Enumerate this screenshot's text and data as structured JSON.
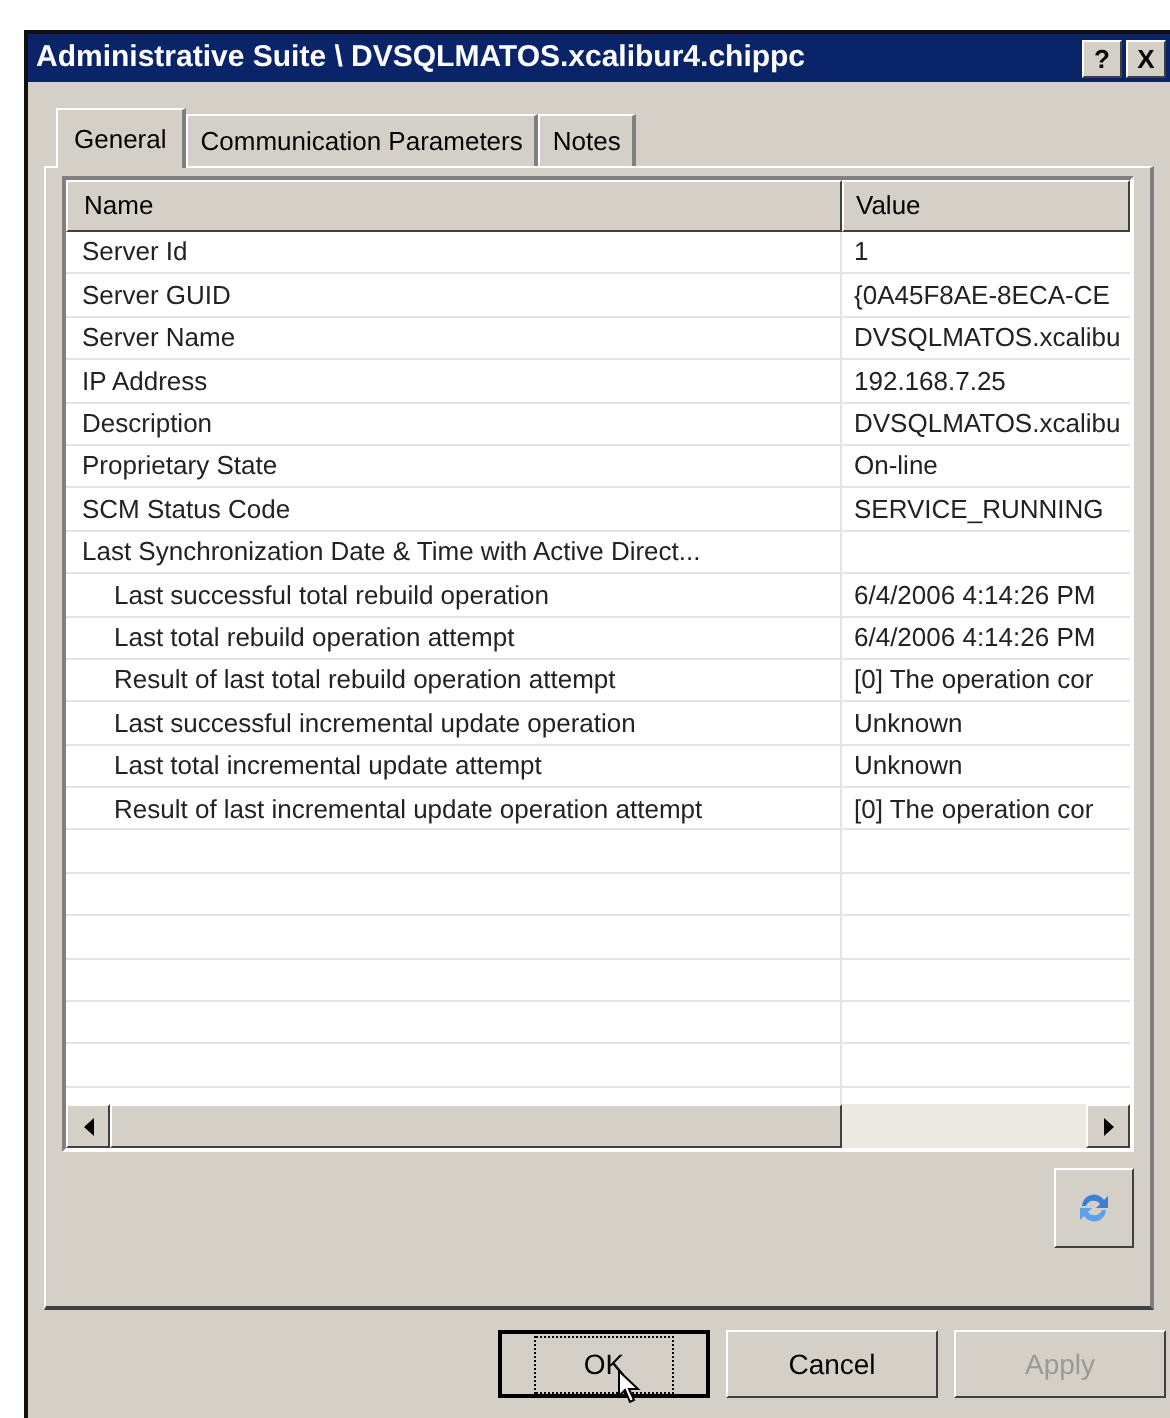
{
  "window": {
    "title": "Administrative Suite \\ DVSQLMATOS.xcalibur4.chippc",
    "help": "?",
    "close": "X"
  },
  "tabs": [
    {
      "label": "General",
      "selected": true
    },
    {
      "label": "Communication Parameters",
      "selected": false
    },
    {
      "label": "Notes",
      "selected": false
    }
  ],
  "table": {
    "columns": [
      "Name",
      "Value"
    ],
    "rows": [
      {
        "name": "Server Id",
        "value": "1"
      },
      {
        "name": "Server GUID",
        "value": "{0A45F8AE-8ECA-CE"
      },
      {
        "name": "Server Name",
        "value": "DVSQLMATOS.xcalibu"
      },
      {
        "name": "IP Address",
        "value": "192.168.7.25"
      },
      {
        "name": "Description",
        "value": "DVSQLMATOS.xcalibu"
      },
      {
        "name": "Proprietary State",
        "value": "On-line"
      },
      {
        "name": "SCM Status Code",
        "value": "SERVICE_RUNNING"
      },
      {
        "name": "Last Synchronization Date & Time with Active Direct...",
        "children": [
          {
            "name": "Last successful total rebuild operation",
            "value": "6/4/2006 4:14:26 PM"
          },
          {
            "name": "Last total rebuild operation attempt",
            "value": "6/4/2006 4:14:26 PM"
          },
          {
            "name": "Result of last total rebuild operation attempt",
            "value": "[0] The operation cor"
          },
          {
            "name": "Last successful incremental update operation",
            "value": "Unknown"
          },
          {
            "name": "Last total incremental update attempt",
            "value": "Unknown"
          },
          {
            "name": "Result of last incremental update operation attempt",
            "value": "[0] The operation cor"
          }
        ]
      }
    ]
  },
  "buttons": [
    {
      "label": "OK",
      "focused": true,
      "disabled": false
    },
    {
      "label": "Cancel",
      "focused": false,
      "disabled": false
    },
    {
      "label": "Apply",
      "focused": false,
      "disabled": true
    }
  ]
}
